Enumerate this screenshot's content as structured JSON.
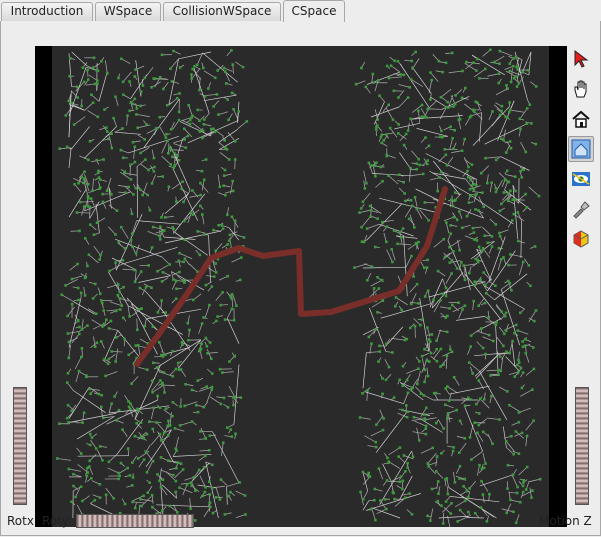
{
  "tabs": [
    {
      "label": "Introduction"
    },
    {
      "label": "WSpace"
    },
    {
      "label": "CollisionWSpace"
    },
    {
      "label": "CSpace"
    }
  ],
  "active_tab": "CSpace",
  "toolbar": {
    "tools": [
      "select-arrow-icon",
      "hand-pan-icon",
      "home-view-icon",
      "view-all-icon",
      "set-view-eye-icon",
      "seek-flashlight-icon",
      "toggle-projection-icon"
    ],
    "selected_tool": "view-all-icon"
  },
  "wheels": {
    "rotx_label": "Rotx",
    "roty_label": "Roty",
    "motionz_label": "Motion Z"
  },
  "colors": {
    "viewport_border": "#000000",
    "viewport_bg": "#2a2a2a",
    "tree_edge": "#a0a0a0",
    "tree_node": "#3e9a3e",
    "path": "#7a2e2a"
  }
}
